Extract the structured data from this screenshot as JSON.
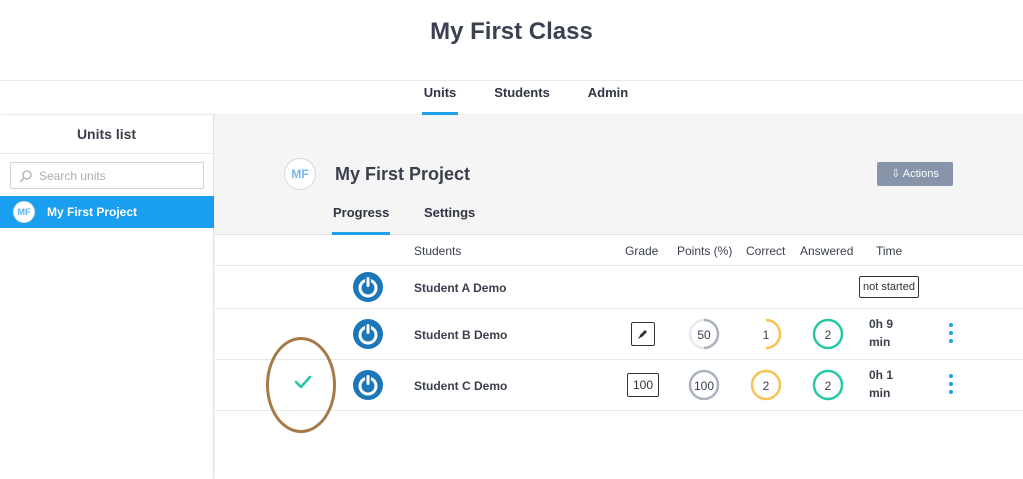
{
  "header": {
    "class_title": "My First Class"
  },
  "top_tabs": [
    {
      "label": "Units",
      "active": true
    },
    {
      "label": "Students",
      "active": false
    },
    {
      "label": "Admin",
      "active": false
    }
  ],
  "sidebar": {
    "title": "Units list",
    "search_placeholder": "Search units",
    "items": [
      {
        "avatar": "MF",
        "label": "My First Project",
        "selected": true
      }
    ]
  },
  "project": {
    "avatar": "MF",
    "title": "My First Project",
    "actions_label": "⇩ Actions",
    "tabs": [
      {
        "label": "Progress",
        "active": true
      },
      {
        "label": "Settings",
        "active": false
      }
    ]
  },
  "table": {
    "columns": [
      "Students",
      "Grade",
      "Points (%)",
      "Correct",
      "Answered",
      "Time"
    ],
    "rows": [
      {
        "name": "Student A Demo",
        "status": "not started"
      },
      {
        "name": "Student B Demo",
        "grade_icon": "pencil-icon",
        "points": "50",
        "correct": "1",
        "answered": "2",
        "time_line1": "0h 9",
        "time_line2": "min"
      },
      {
        "name": "Student C Demo",
        "grade": "100",
        "points": "100",
        "correct": "2",
        "answered": "2",
        "time_line1": "0h 1",
        "time_line2": "min",
        "checked": true
      }
    ]
  },
  "colors": {
    "accent": "#1fa0e8",
    "points_ring": "#aab2bd",
    "correct_ring": "#f5c452",
    "answered_ring": "#26c9a3",
    "power_icon": "#1b77b8",
    "highlight": "#a57a47",
    "check": "#26c9a3"
  }
}
